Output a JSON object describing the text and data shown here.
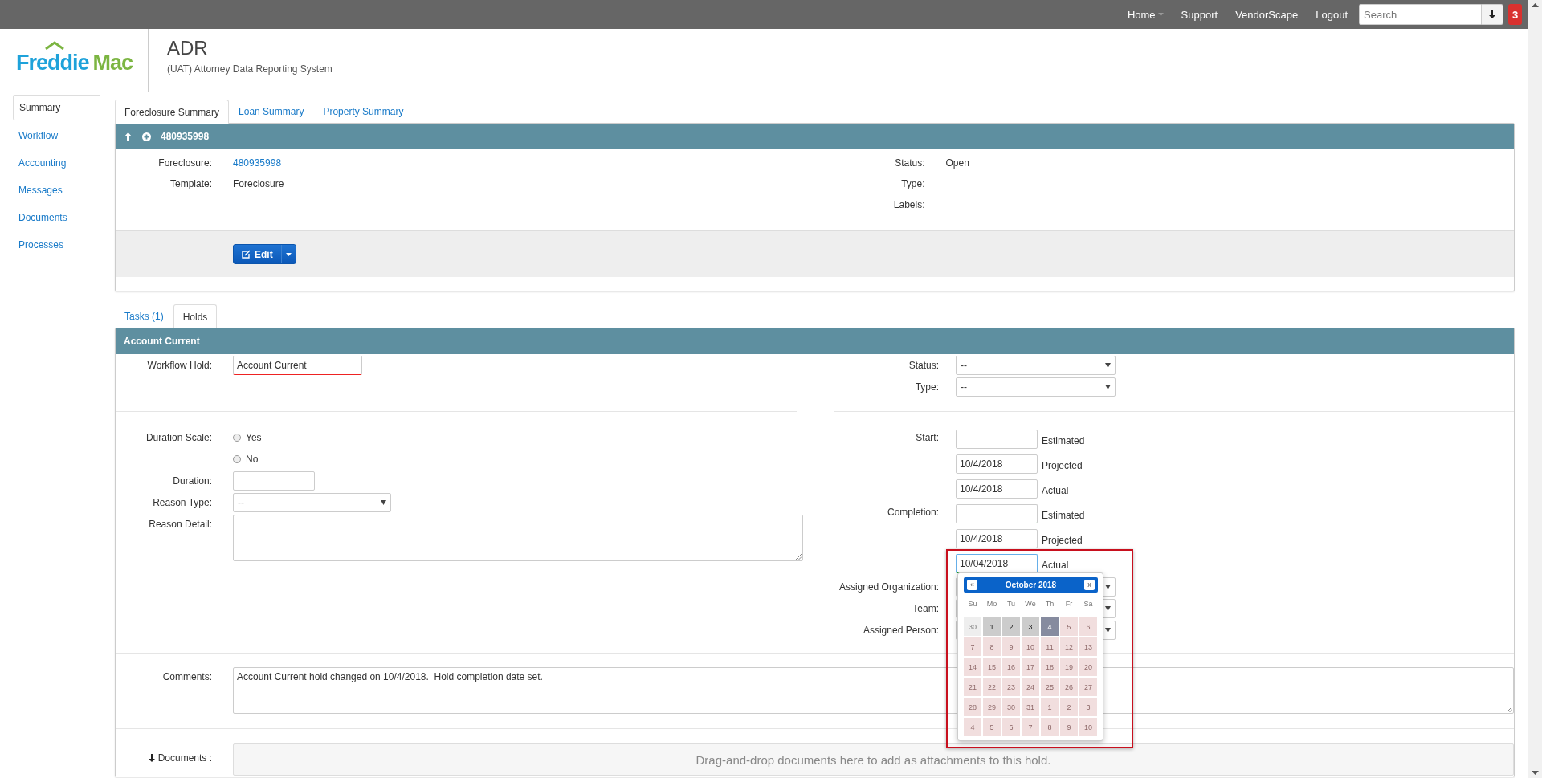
{
  "topbar": {
    "links": [
      {
        "label": "Home",
        "dropdown": true
      },
      {
        "label": "Support",
        "dropdown": false
      },
      {
        "label": "VendorScape",
        "dropdown": false
      },
      {
        "label": "Logout",
        "dropdown": false
      }
    ],
    "search": {
      "placeholder": "Search"
    },
    "notifications": "3"
  },
  "header": {
    "logo": {
      "first": "Freddie",
      "second": "Mac"
    },
    "title": "ADR",
    "subtitle": "(UAT) Attorney Data Reporting System"
  },
  "sidebar": {
    "items": [
      {
        "label": "Summary",
        "selected": true
      },
      {
        "label": "Workflow",
        "selected": false
      },
      {
        "label": "Accounting",
        "selected": false
      },
      {
        "label": "Messages",
        "selected": false
      },
      {
        "label": "Documents",
        "selected": false
      },
      {
        "label": "Processes",
        "selected": false
      }
    ]
  },
  "summary_tabs": [
    {
      "label": "Foreclosure Summary",
      "selected": true
    },
    {
      "label": "Loan Summary",
      "selected": false
    },
    {
      "label": "Property Summary",
      "selected": false
    }
  ],
  "foreclosure_panel": {
    "title": "480935998",
    "left_fields": [
      {
        "label": "Foreclosure:",
        "value": "480935998",
        "link": true
      },
      {
        "label": "Template:",
        "value": "Foreclosure",
        "link": false
      }
    ],
    "right_fields": [
      {
        "label": "Status:",
        "value": "Open"
      },
      {
        "label": "Type:"
      },
      {
        "label": "Labels:"
      }
    ],
    "edit_button": "Edit"
  },
  "hold_tabs": [
    {
      "label": "Tasks (1)",
      "selected": false
    },
    {
      "label": "Holds",
      "selected": true
    }
  ],
  "hold_panel": {
    "title": "Account Current",
    "workflow_hold": {
      "label": "Workflow Hold:",
      "value": "Account Current",
      "invalid": true
    },
    "top_right": [
      {
        "label": "Status:",
        "value": "--"
      },
      {
        "label": "Type:",
        "value": "--"
      }
    ],
    "duration_scale": {
      "label": "Duration Scale:",
      "options": [
        {
          "label": "Yes",
          "selected": false
        },
        {
          "label": "No",
          "selected": false
        }
      ]
    },
    "duration": {
      "label": "Duration:"
    },
    "reason_type": {
      "label": "Reason Type:",
      "value": "--"
    },
    "reason_detail": {
      "label": "Reason Detail:"
    },
    "dates": [
      {
        "label": "Start:",
        "inputs": [
          {
            "note": "Estimated",
            "valid": false,
            "focused": false
          },
          {
            "value": "10/4/2018",
            "note": "Projected",
            "valid": false,
            "focused": false
          },
          {
            "value": "10/4/2018",
            "note": "Actual",
            "valid": false,
            "focused": false
          }
        ]
      },
      {
        "label": "Completion:",
        "inputs": [
          {
            "note": "Estimated",
            "valid": true,
            "focused": false
          },
          {
            "value": "10/4/2018",
            "note": "Projected",
            "valid": false,
            "focused": false
          },
          {
            "value": "10/04/2018",
            "note": "Actual",
            "valid": true,
            "focused": true
          }
        ]
      }
    ],
    "assignments": [
      {
        "label": "Assigned Organization:"
      },
      {
        "label": "Team:"
      },
      {
        "label": "Assigned Person:"
      }
    ],
    "datepicker": {
      "month": "October 2018",
      "prev": "«",
      "close": "x",
      "weekdays": [
        "Su",
        "Mo",
        "Tu",
        "We",
        "Th",
        "Fr",
        "Sa"
      ],
      "days": [
        {
          "label": "30",
          "kind": "other",
          "selected": false
        },
        {
          "label": "1",
          "kind": "available",
          "selected": false
        },
        {
          "label": "2",
          "kind": "available",
          "selected": false
        },
        {
          "label": "3",
          "kind": "available",
          "selected": false
        },
        {
          "label": "4",
          "kind": "available",
          "selected": true
        },
        {
          "label": "5",
          "kind": "disabled",
          "selected": false
        },
        {
          "label": "6",
          "kind": "disabled",
          "selected": false
        },
        {
          "label": "7",
          "kind": "disabled",
          "selected": false
        },
        {
          "label": "8",
          "kind": "disabled",
          "selected": false
        },
        {
          "label": "9",
          "kind": "disabled",
          "selected": false
        },
        {
          "label": "10",
          "kind": "disabled",
          "selected": false
        },
        {
          "label": "11",
          "kind": "disabled",
          "selected": false
        },
        {
          "label": "12",
          "kind": "disabled",
          "selected": false
        },
        {
          "label": "13",
          "kind": "disabled",
          "selected": false
        },
        {
          "label": "14",
          "kind": "disabled",
          "selected": false
        },
        {
          "label": "15",
          "kind": "disabled",
          "selected": false
        },
        {
          "label": "16",
          "kind": "disabled",
          "selected": false
        },
        {
          "label": "17",
          "kind": "disabled",
          "selected": false
        },
        {
          "label": "18",
          "kind": "disabled",
          "selected": false
        },
        {
          "label": "19",
          "kind": "disabled",
          "selected": false
        },
        {
          "label": "20",
          "kind": "disabled",
          "selected": false
        },
        {
          "label": "21",
          "kind": "disabled",
          "selected": false
        },
        {
          "label": "22",
          "kind": "disabled",
          "selected": false
        },
        {
          "label": "23",
          "kind": "disabled",
          "selected": false
        },
        {
          "label": "24",
          "kind": "disabled",
          "selected": false
        },
        {
          "label": "25",
          "kind": "disabled",
          "selected": false
        },
        {
          "label": "26",
          "kind": "disabled",
          "selected": false
        },
        {
          "label": "27",
          "kind": "disabled",
          "selected": false
        },
        {
          "label": "28",
          "kind": "disabled",
          "selected": false
        },
        {
          "label": "29",
          "kind": "disabled",
          "selected": false
        },
        {
          "label": "30",
          "kind": "disabled",
          "selected": false
        },
        {
          "label": "31",
          "kind": "disabled",
          "selected": false
        },
        {
          "label": "1",
          "kind": "disabled",
          "selected": false
        },
        {
          "label": "2",
          "kind": "disabled",
          "selected": false
        },
        {
          "label": "3",
          "kind": "disabled",
          "selected": false
        },
        {
          "label": "4",
          "kind": "disabled",
          "selected": false
        },
        {
          "label": "5",
          "kind": "disabled",
          "selected": false
        },
        {
          "label": "6",
          "kind": "disabled",
          "selected": false
        },
        {
          "label": "7",
          "kind": "disabled",
          "selected": false
        },
        {
          "label": "8",
          "kind": "disabled",
          "selected": false
        },
        {
          "label": "9",
          "kind": "disabled",
          "selected": false
        },
        {
          "label": "10",
          "kind": "disabled",
          "selected": false
        }
      ]
    },
    "comments": {
      "label": "Comments:",
      "value": "Account Current hold changed on 10/4/2018.  Hold completion date set."
    },
    "documents": {
      "label": "Documents :",
      "dropzone": "Drag-and-drop documents here to add as attachments to this hold."
    }
  }
}
